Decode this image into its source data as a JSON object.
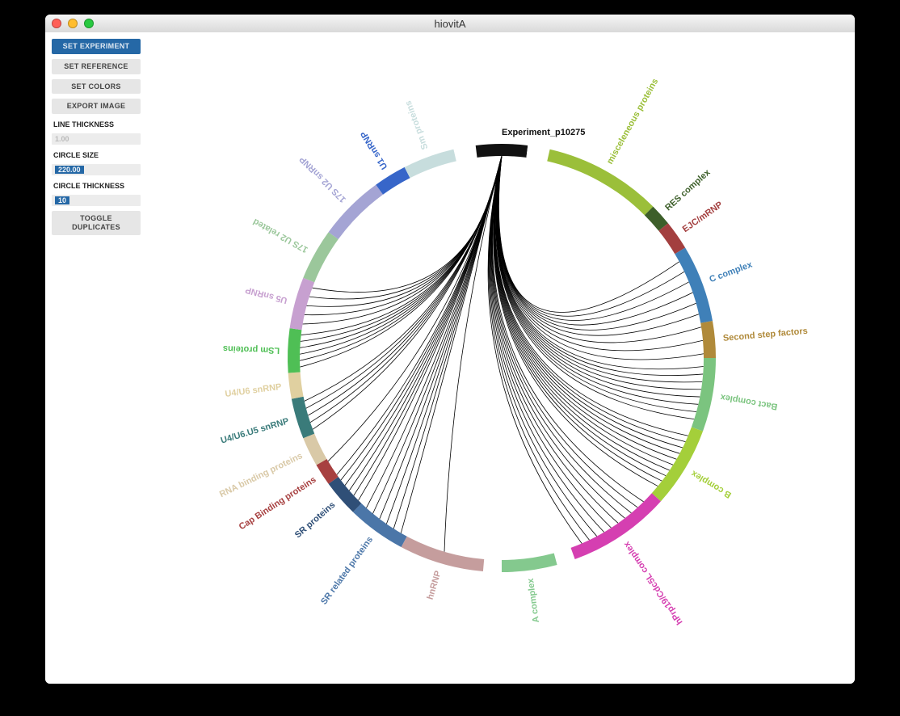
{
  "window": {
    "title": "hiovitA"
  },
  "sidebar": {
    "set_experiment": "SET EXPERIMENT",
    "set_reference": "SET REFERENCE",
    "set_colors": "SET COLORS",
    "export_image": "EXPORT IMAGE",
    "line_thickness_label": "LINE THICKNESS",
    "line_thickness_value": "1.00",
    "circle_size_label": "CIRCLE SIZE",
    "circle_size_value": "220.00",
    "circle_thickness_label": "CIRCLE THICKNESS",
    "circle_thickness_value": "10",
    "toggle_duplicates": "TOGGLE\nDUPLICATES"
  },
  "chart_data": {
    "type": "chord",
    "center_segment": {
      "label": "Experiment_p10275",
      "color": "#111111"
    },
    "segments": [
      {
        "label": "Second step factors",
        "start_deg": 80,
        "end_deg": 90,
        "color": "#b08a3a",
        "links": 3
      },
      {
        "label": "Bact complex",
        "start_deg": 90,
        "end_deg": 110,
        "color": "#7bc47f",
        "links": 8
      },
      {
        "label": "B complex",
        "start_deg": 110,
        "end_deg": 132,
        "color": "#a4cf3a",
        "links": 10
      },
      {
        "label": "hPrp19/Cdc5L complex",
        "start_deg": 132,
        "end_deg": 160,
        "color": "#d53fb1",
        "links": 10
      },
      {
        "label": "A complex",
        "start_deg": 165,
        "end_deg": 180,
        "color": "#84c98e",
        "links": 0
      },
      {
        "label": "hnRNP",
        "start_deg": 185,
        "end_deg": 208,
        "color": "#c59d9d",
        "links": 1
      },
      {
        "label": "SR related proteins",
        "start_deg": 208,
        "end_deg": 224,
        "color": "#4b76a8",
        "links": 6
      },
      {
        "label": "SR proteins",
        "start_deg": 224,
        "end_deg": 234,
        "color": "#2f4f77",
        "links": 5
      },
      {
        "label": "Cap Binding proteins",
        "start_deg": 234,
        "end_deg": 240,
        "color": "#a74040",
        "links": 2
      },
      {
        "label": "RNA binding proteins",
        "start_deg": 240,
        "end_deg": 248,
        "color": "#d9c9a7",
        "links": 0
      },
      {
        "label": "U4/U6.U5 snRNP",
        "start_deg": 248,
        "end_deg": 259,
        "color": "#3a7b7a",
        "links": 5
      },
      {
        "label": "U4/U6 snRNP",
        "start_deg": 259,
        "end_deg": 266,
        "color": "#e0d0a0",
        "links": 0
      },
      {
        "label": "LSm proteins",
        "start_deg": 266,
        "end_deg": 278,
        "color": "#4fbf55",
        "links": 6
      },
      {
        "label": "U5 snRNP",
        "start_deg": 278,
        "end_deg": 292,
        "color": "#c7a0d0",
        "links": 5
      },
      {
        "label": "17S U2 related",
        "start_deg": 292,
        "end_deg": 306,
        "color": "#9bc79b",
        "links": 0
      },
      {
        "label": "17S U2 snRNP",
        "start_deg": 306,
        "end_deg": 324,
        "color": "#a4a4d4",
        "links": 0
      },
      {
        "label": "U1 snRNP",
        "start_deg": 324,
        "end_deg": 333,
        "color": "#3766c9",
        "links": 0
      },
      {
        "label": "Sm proteins",
        "start_deg": 333,
        "end_deg": 347,
        "color": "#c7dddd",
        "links": 0
      },
      {
        "label": "misceleneous proteins",
        "start_deg": 13,
        "end_deg": 45,
        "color": "#9bbf3a",
        "links": 0
      },
      {
        "label": "RES complex",
        "start_deg": 45,
        "end_deg": 51,
        "color": "#3d5f2a",
        "links": 0
      },
      {
        "label": "EJC/mRNP",
        "start_deg": 51,
        "end_deg": 59,
        "color": "#a33f3f",
        "links": 0
      },
      {
        "label": "C complex",
        "start_deg": 59,
        "end_deg": 80,
        "color": "#3f80b8",
        "links": 6
      }
    ],
    "experiment_arc": {
      "start_deg": 353,
      "end_deg": 367
    }
  }
}
